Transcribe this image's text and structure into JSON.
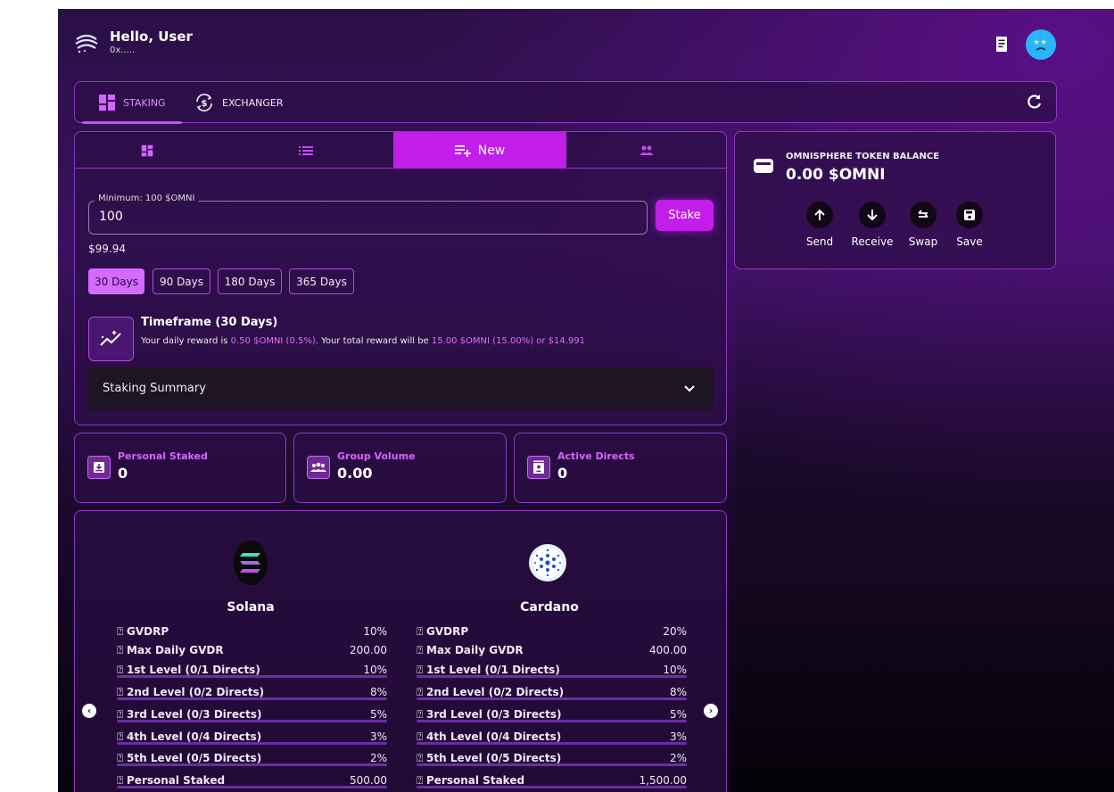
{
  "header": {
    "greeting": "Hello, User",
    "address": "0x....."
  },
  "tabs": [
    {
      "label": "STAKING"
    },
    {
      "label": "EXCHANGER"
    }
  ],
  "subtabs": {
    "new_label": "New"
  },
  "stake": {
    "min_label": "Minimum: 100 $OMNI",
    "amount": "100",
    "button": "Stake",
    "usd_value": "$99.94",
    "durations": [
      "30 Days",
      "90 Days",
      "180 Days",
      "365 Days"
    ],
    "timeframe_title": "Timeframe (30 Days)",
    "desc_prefix": "Your daily reward is ",
    "daily_reward": "0.50 $OMNI (0.5%)",
    "desc_middle": ". Your total reward will be ",
    "total_reward": "15.00 $OMNI (15.00%) or $14.991",
    "summary_label": "Staking Summary"
  },
  "balance": {
    "label": "OMNISPHERE TOKEN BALANCE",
    "value": "0.00 $OMNI",
    "actions": [
      "Send",
      "Receive",
      "Swap",
      "Save"
    ]
  },
  "stats": [
    {
      "label": "Personal Staked",
      "value": "0"
    },
    {
      "label": "Group Volume",
      "value": "0.00"
    },
    {
      "label": "Active Directs",
      "value": "0"
    }
  ],
  "coins": [
    {
      "name": "Solana",
      "rows": [
        {
          "label": "GVDRP",
          "value": "10%",
          "bar": false
        },
        {
          "label": "Max Daily GVDR",
          "value": "200.00",
          "bar": false
        },
        {
          "label": "1st Level (0/1 Directs)",
          "value": "10%",
          "bar": true
        },
        {
          "label": "2nd Level (0/2 Directs)",
          "value": "8%",
          "bar": true
        },
        {
          "label": "3rd Level (0/3 Directs)",
          "value": "5%",
          "bar": true
        },
        {
          "label": "4th Level (0/4 Directs)",
          "value": "3%",
          "bar": true
        },
        {
          "label": "5th Level (0/5 Directs)",
          "value": "2%",
          "bar": true
        },
        {
          "label": "Personal Staked",
          "value": "500.00",
          "bar": true
        }
      ]
    },
    {
      "name": "Cardano",
      "rows": [
        {
          "label": "GVDRP",
          "value": "20%",
          "bar": false
        },
        {
          "label": "Max Daily GVDR",
          "value": "400.00",
          "bar": false
        },
        {
          "label": "1st Level (0/1 Directs)",
          "value": "10%",
          "bar": true
        },
        {
          "label": "2nd Level (0/2 Directs)",
          "value": "8%",
          "bar": true
        },
        {
          "label": "3rd Level (0/3 Directs)",
          "value": "5%",
          "bar": true
        },
        {
          "label": "4th Level (0/4 Directs)",
          "value": "3%",
          "bar": true
        },
        {
          "label": "5th Level (0/5 Directs)",
          "value": "2%",
          "bar": true
        },
        {
          "label": "Personal Staked",
          "value": "1,500.00",
          "bar": true
        }
      ]
    }
  ],
  "colors": {
    "accent": "#c21eea",
    "highlight": "#e36cff",
    "border": "#8a3bbf"
  },
  "icons": [
    "logo-icon",
    "document-icon",
    "avatar-icon",
    "dashboard-icon",
    "exchange-icon",
    "refresh-icon",
    "list-icon",
    "new-list-icon",
    "group-icon",
    "trend-icon",
    "chevron-down-icon",
    "wallet-icon",
    "arrow-up-icon",
    "arrow-down-icon",
    "swap-icon",
    "save-icon",
    "solana-logo",
    "cardano-logo",
    "help-icon",
    "chevron-left-icon",
    "chevron-right-icon"
  ]
}
